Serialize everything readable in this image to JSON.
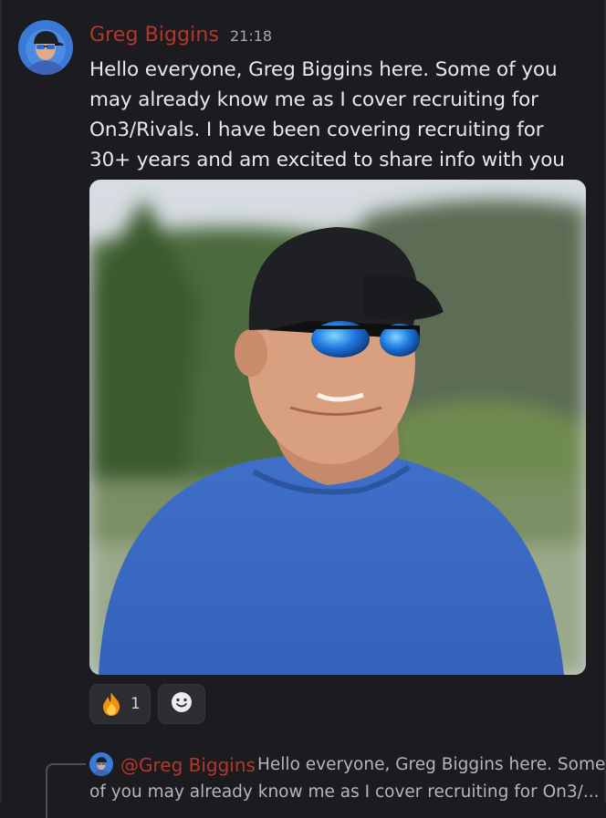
{
  "message": {
    "author": "Greg Biggins",
    "author_color": "#b4372b",
    "timestamp": "21:18",
    "content": "Hello everyone, Greg Biggins here. Some of you may already know me as I cover recruiting for On3/Rivals. I have been covering recruiting for 30+ years and am excited to share info with you guys!",
    "avatar_icon": "user-avatar",
    "attachment_icon": "photo-attachment"
  },
  "reactions": [
    {
      "emoji": "fire",
      "count": "1"
    }
  ],
  "add_reaction_icon": "smiley-add-reaction-icon",
  "reply": {
    "mention": "@Greg Biggins",
    "text_line1": "Hello everyone, Greg Biggins here. Some",
    "text_line2": "of you may already know me as I cover recruiting for On3/..."
  }
}
